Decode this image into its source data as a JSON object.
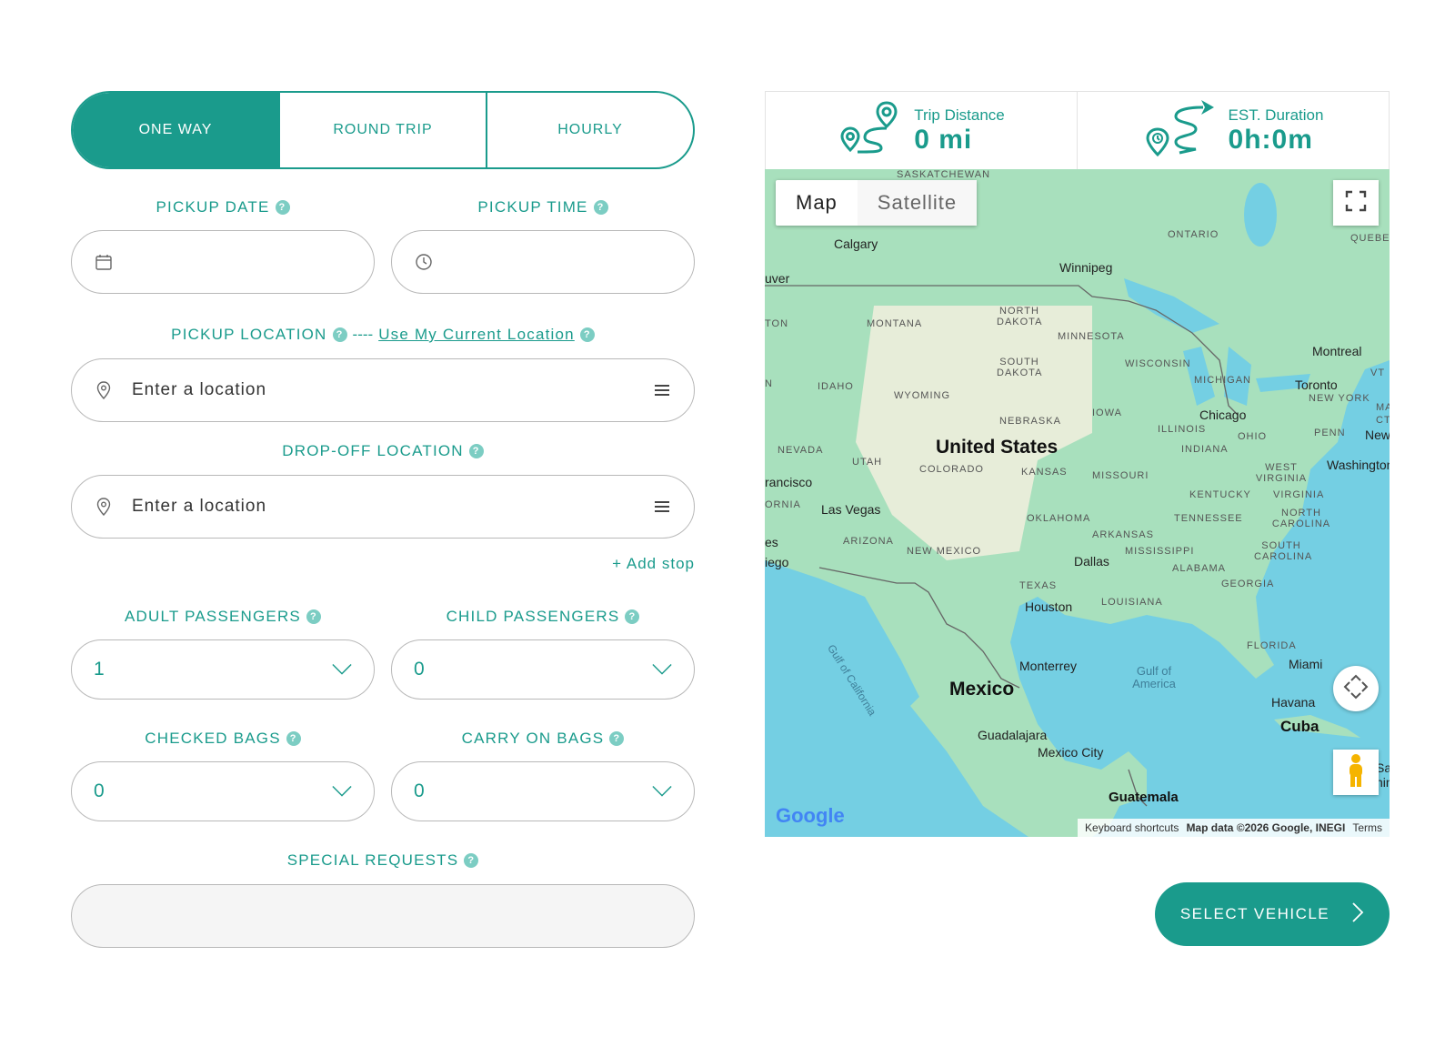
{
  "trip_types": [
    {
      "label": "ONE WAY",
      "active": true
    },
    {
      "label": "ROUND TRIP",
      "active": false
    },
    {
      "label": "HOURLY",
      "active": false
    }
  ],
  "form": {
    "pickup_date_label": "PICKUP DATE",
    "pickup_time_label": "PICKUP TIME",
    "pickup_location_label": "PICKUP LOCATION",
    "use_location_link": "Use My Current Location",
    "use_location_prefix": "----",
    "pickup_location_placeholder": "Enter a location",
    "dropoff_location_label": "DROP-OFF LOCATION",
    "dropoff_location_placeholder": "Enter a location",
    "add_stop": "+ Add stop",
    "adult_passengers_label": "ADULT PASSENGERS",
    "adult_passengers_value": "1",
    "child_passengers_label": "CHILD PASSENGERS",
    "child_passengers_value": "0",
    "checked_bags_label": "CHECKED BAGS",
    "checked_bags_value": "0",
    "carry_on_bags_label": "CARRY ON BAGS",
    "carry_on_bags_value": "0",
    "special_requests_label": "SPECIAL REQUESTS",
    "help_glyph": "?"
  },
  "stats": {
    "distance_label": "Trip Distance",
    "distance_value": "0 mi",
    "duration_label": "EST. Duration",
    "duration_value": "0h:0m"
  },
  "map": {
    "type_buttons": [
      "Map",
      "Satellite"
    ],
    "google": "Google",
    "attribution": {
      "shortcuts": "Keyboard shortcuts",
      "data": "Map data ©2026 Google, INEGI",
      "terms": "Terms"
    },
    "countries": [
      "United States",
      "Mexico",
      "Cuba",
      "Guatemala"
    ],
    "cities": [
      "Calgary",
      "Winnipeg",
      "Montreal",
      "Toronto",
      "Chicago",
      "Washington",
      "New",
      "Las Vegas",
      "Dallas",
      "Houston",
      "Monterrey",
      "Miami",
      "Havana",
      "Guadalajara",
      "Mexico City",
      "rancisco",
      "iego",
      "es"
    ],
    "states": [
      "SASKATCHEWAN",
      "ONTARIO",
      "QUEBEC",
      "MONTANA",
      "NORTH DAKOTA",
      "MINNESOTA",
      "SOUTH DAKOTA",
      "WISCONSIN",
      "MICHIGAN",
      "IDAHO",
      "WYOMING",
      "IOWA",
      "NEBRASKA",
      "ILLINOIS",
      "NEW YORK",
      "OHIO",
      "PENN",
      "INDIANA",
      "NEVADA",
      "UTAH",
      "COLORADO",
      "KANSAS",
      "MISSOURI",
      "WEST VIRGINIA",
      "KENTUCKY",
      "VIRGINIA",
      "ORNIA",
      "TENNESSEE",
      "NORTH CAROLINA",
      "OKLAHOMA",
      "ARKANSAS",
      "ARIZONA",
      "NEW MEXICO",
      "MISSISSIPPI",
      "SOUTH CAROLINA",
      "ALABAMA",
      "TEXAS",
      "GEORGIA",
      "LOUISIANA",
      "FLORIDA",
      "TON",
      "uver",
      "VT",
      "N",
      "MA",
      "CT"
    ],
    "water": [
      "Gulf of America",
      "Gulf of California"
    ],
    "edge_text": [
      "Sa",
      "nin"
    ]
  },
  "select_vehicle": "SELECT VEHICLE",
  "colors": {
    "accent": "#1a9b8c",
    "accent_light": "#7ccdc3",
    "border": "#b8b8b8"
  }
}
